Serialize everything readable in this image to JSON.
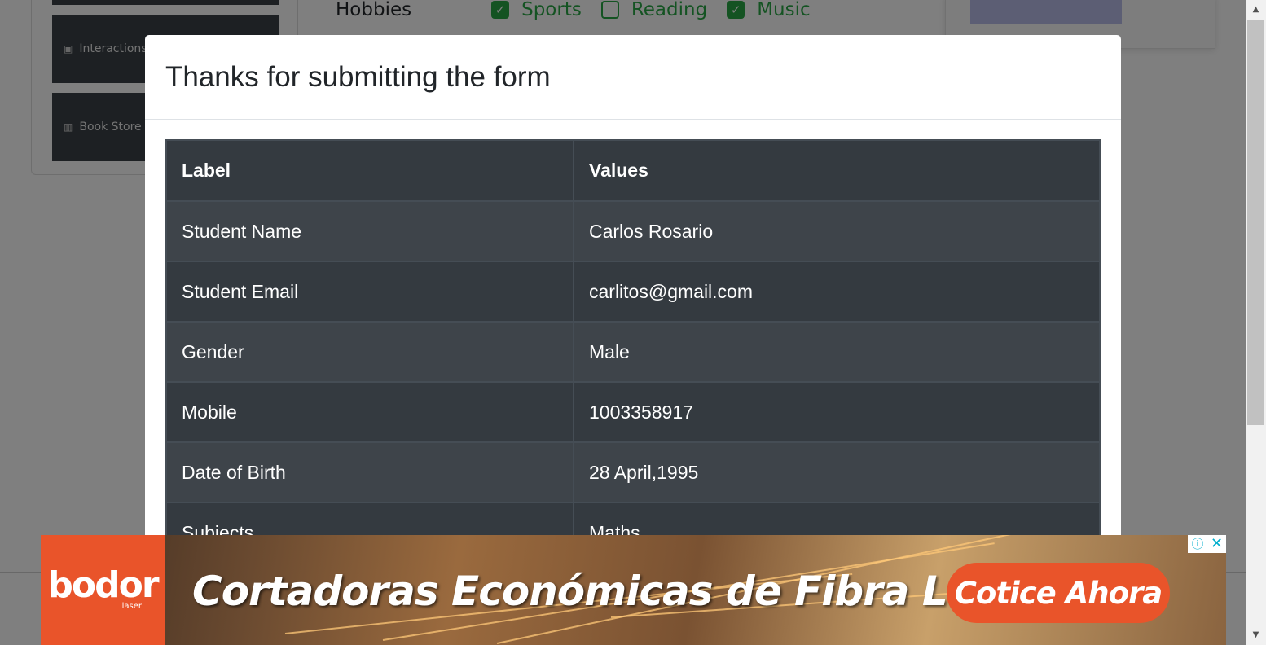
{
  "background": {
    "sidebar": {
      "items": [
        {
          "label": "",
          "icon": "none"
        },
        {
          "label": "Interactions",
          "icon": "square-icon"
        },
        {
          "label": "Book Store A",
          "icon": "books-icon"
        }
      ]
    },
    "hobbies": {
      "label": "Hobbies",
      "options": [
        {
          "label": "Sports",
          "checked": true
        },
        {
          "label": "Reading",
          "checked": false
        },
        {
          "label": "Music",
          "checked": true
        }
      ]
    }
  },
  "modal": {
    "title": "Thanks for submitting the form",
    "table": {
      "headers": [
        "Label",
        "Values"
      ],
      "rows": [
        {
          "label": "Student Name",
          "value": "Carlos Rosario"
        },
        {
          "label": "Student Email",
          "value": "carlitos@gmail.com"
        },
        {
          "label": "Gender",
          "value": "Male"
        },
        {
          "label": "Mobile",
          "value": "1003358917"
        },
        {
          "label": "Date of Birth",
          "value": "28 April,1995"
        },
        {
          "label": "Subjects",
          "value": "Maths"
        }
      ]
    }
  },
  "ad": {
    "brand": "bodor",
    "brand_sub": "laser",
    "headline": "Cortadoras Económicas de Fibra Láser",
    "cta": "Cotice Ahora",
    "info_glyph": "ⓘ",
    "close_glyph": "✕",
    "colors": {
      "brand": "#e9542a",
      "icons": "#00aecd"
    }
  },
  "colors": {
    "table_dark": "#343a40",
    "table_striped": "#3e444a",
    "checkbox_green": "#28a745"
  }
}
